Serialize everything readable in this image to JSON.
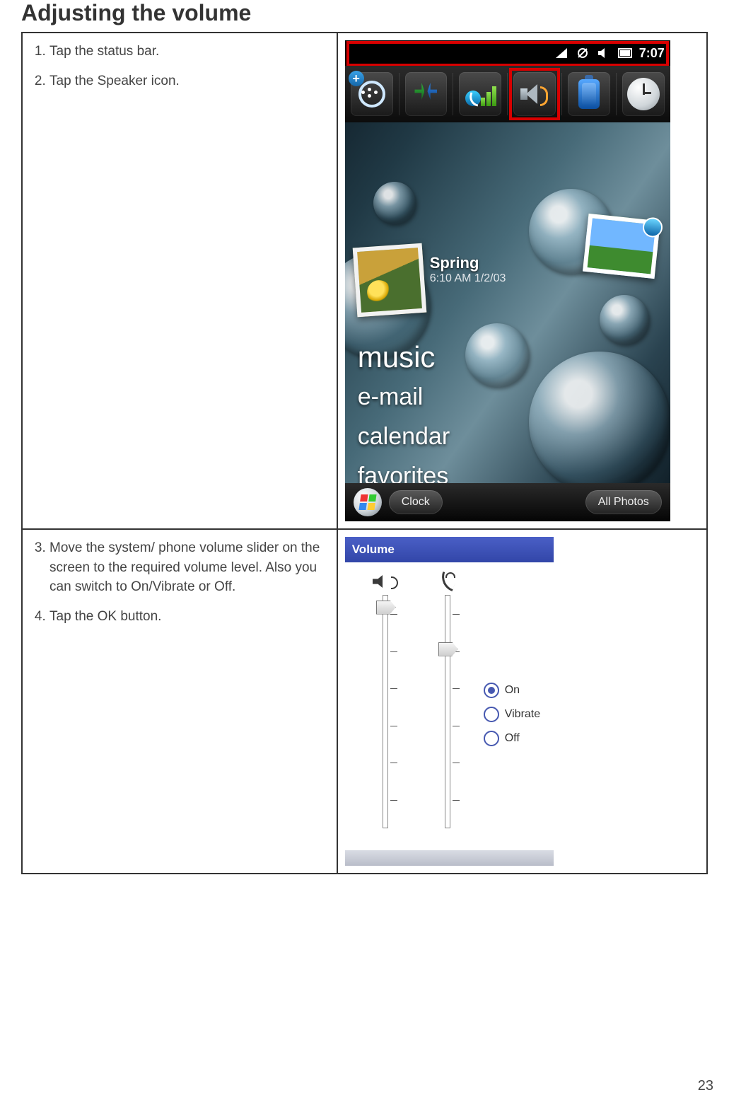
{
  "page": {
    "title": "Adjusting the volume",
    "number": "23"
  },
  "steps_a": [
    "Tap the status bar.",
    "Tap the Speaker icon."
  ],
  "steps_b": [
    "Move the system/ phone volume slider on the screen to the required volume level. Also you can switch to On/Vibrate or Off.",
    "Tap the OK button."
  ],
  "screenshot1": {
    "status_time": "7:07",
    "media_title": "Spring",
    "media_subtitle": "6:10 AM 1/2/03",
    "menu_items": [
      "music",
      "e-mail",
      "calendar",
      "favorites"
    ],
    "bottom_left_label": "Clock",
    "bottom_right_label": "All Photos"
  },
  "screenshot2": {
    "header": "Volume",
    "radio_options": [
      "On",
      "Vibrate",
      "Off"
    ],
    "radio_selected": "On"
  }
}
